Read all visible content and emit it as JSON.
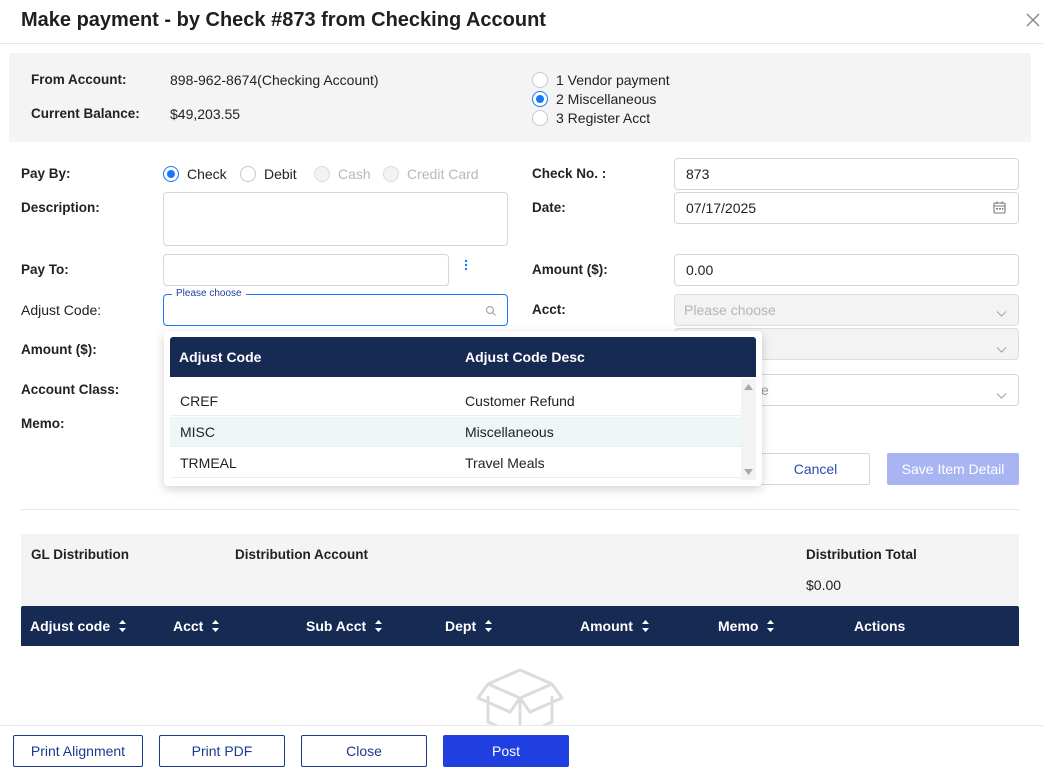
{
  "title": "Make payment - by Check #873 from Checking Account",
  "info": {
    "from_account_label": "From Account",
    "from_account_value": "898-962-8674(Checking Account)",
    "balance_label": "Current Balance",
    "balance_value": "$49,203.55",
    "payment_types": [
      {
        "label": "1 Vendor payment",
        "selected": false
      },
      {
        "label": "2 Miscellaneous",
        "selected": true
      },
      {
        "label": "3 Register Acct",
        "selected": false
      }
    ]
  },
  "form": {
    "pay_by_label": "Pay By",
    "pay_by_options": [
      {
        "label": "Check",
        "selected": true,
        "disabled": false
      },
      {
        "label": "Debit",
        "selected": false,
        "disabled": false
      },
      {
        "label": "Cash",
        "selected": false,
        "disabled": true
      },
      {
        "label": "Credit Card",
        "selected": false,
        "disabled": true
      }
    ],
    "description_label": "Description",
    "description_value": "",
    "pay_to_label": "Pay To",
    "pay_to_value": "",
    "adjust_code_label": "Adjust Code",
    "adjust_code_float_label": "Please choose",
    "amount_label": "Amount ($)",
    "account_class_label": "Account Class",
    "memo_label": "Memo",
    "check_no_label": "Check No. ",
    "check_no_value": "873",
    "date_label": "Date",
    "date_value": "07/17/2025",
    "right_amount_label": "Amount ($)",
    "right_amount_value": "0.00",
    "acct_label": "Acct",
    "acct_placeholder": "Please choose",
    "partial_text": "e",
    "cancel_label": "Cancel",
    "save_item_label": "Save Item Detail"
  },
  "adjust_dropdown": {
    "headers": [
      "Adjust Code",
      "Adjust Code Desc"
    ],
    "rows": [
      {
        "code": "CREF",
        "desc": "Customer Refund"
      },
      {
        "code": "MISC",
        "desc": "Miscellaneous"
      },
      {
        "code": "TRMEAL",
        "desc": "Travel Meals"
      }
    ]
  },
  "gl": {
    "gl_distribution_label": "GL Distribution",
    "distribution_account_label": "Distribution Account",
    "distribution_total_label": "Distribution Total",
    "distribution_total_value": "$0.00"
  },
  "table": {
    "columns": [
      "Adjust code",
      "Acct",
      "Sub Acct",
      "Dept",
      "Amount",
      "Memo",
      "Actions"
    ]
  },
  "footer": {
    "print_alignment": "Print Alignment",
    "print_pdf": "Print PDF",
    "close": "Close",
    "post": "Post"
  },
  "colors": {
    "primary": "#1f3fe0",
    "header_navy": "#172a54",
    "radio_blue": "#1677ff"
  }
}
